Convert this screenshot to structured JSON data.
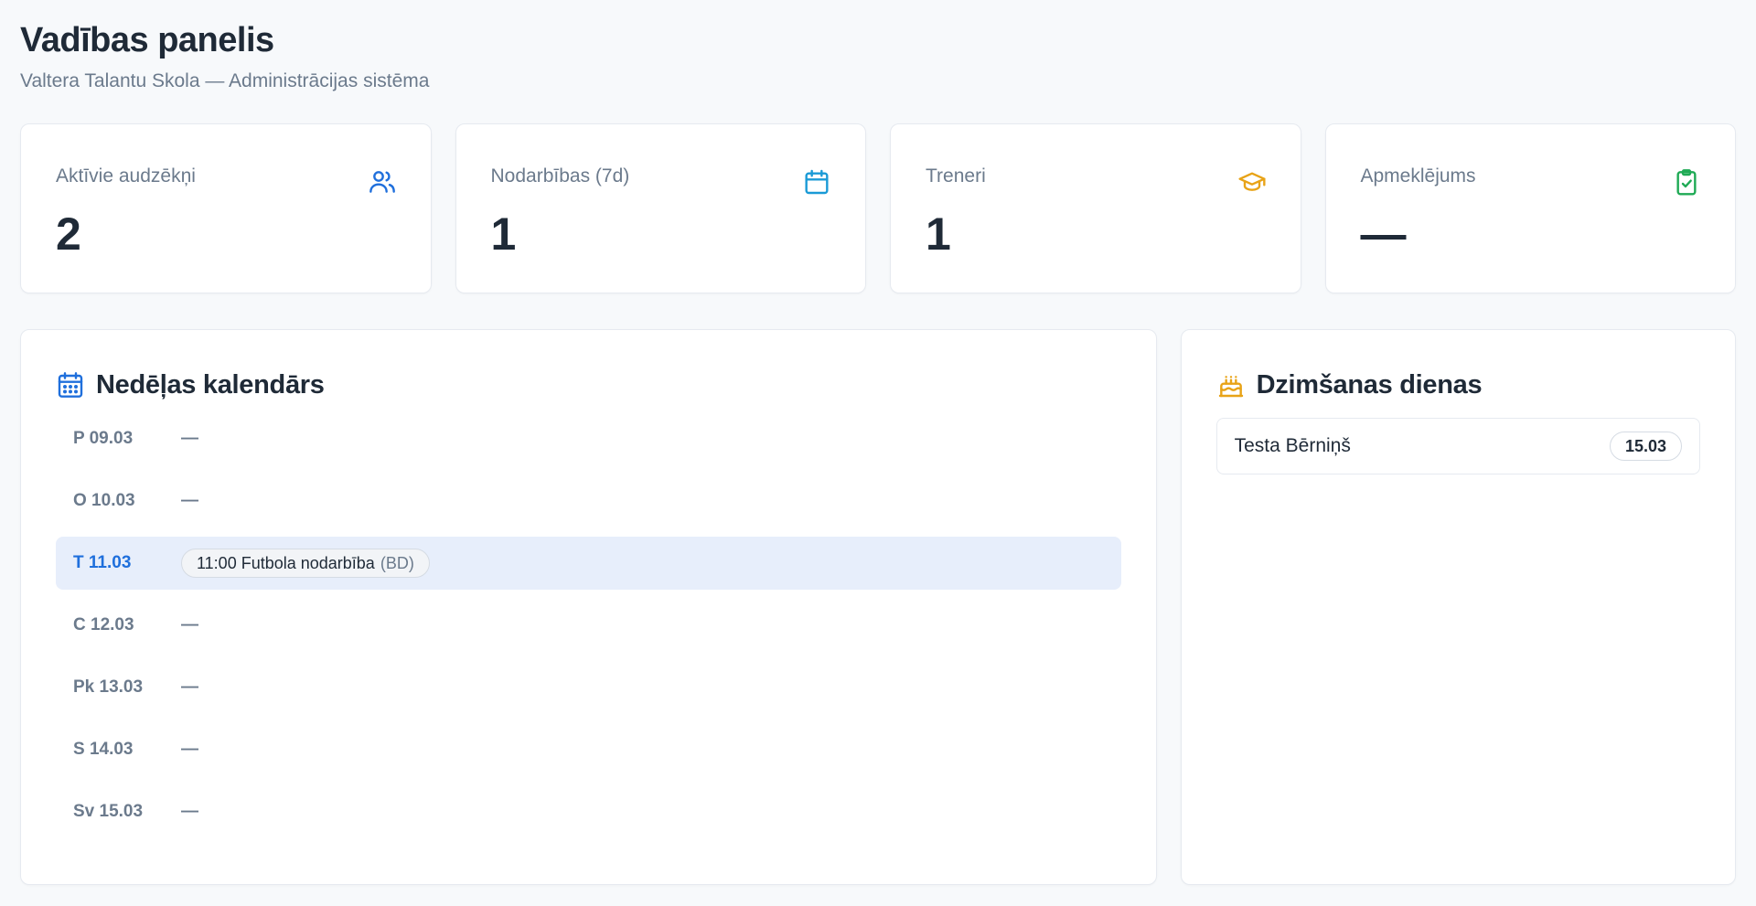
{
  "header": {
    "title": "Vadības panelis",
    "subtitle": "Valtera Talantu Skola — Administrācijas sistēma"
  },
  "stats": [
    {
      "label": "Aktīvie audzēkņi",
      "value": "2",
      "icon": "users-icon",
      "color": "#1f6fdc"
    },
    {
      "label": "Nodarbības (7d)",
      "value": "1",
      "icon": "calendar-icon",
      "color": "#1a9ad6"
    },
    {
      "label": "Treneri",
      "value": "1",
      "icon": "graduation-cap-icon",
      "color": "#e8a317"
    },
    {
      "label": "Apmeklējums",
      "value": "—",
      "icon": "clipboard-check-icon",
      "color": "#1faa55"
    }
  ],
  "calendar": {
    "title": "Nedēļas kalendārs",
    "icon": "calendar-days-icon",
    "days": [
      {
        "day": "P 09.03",
        "text": "—"
      },
      {
        "day": "O 10.03",
        "text": "—"
      },
      {
        "day": "T 11.03",
        "event": "11:00 Futbola nodarbība",
        "location": "(BD)"
      },
      {
        "day": "C 12.03",
        "text": "—"
      },
      {
        "day": "Pk 13.03",
        "text": "—"
      },
      {
        "day": "S 14.03",
        "text": "—"
      },
      {
        "day": "Sv 15.03",
        "text": "—"
      }
    ]
  },
  "birthdays": {
    "title": "Dzimšanas dienas",
    "icon": "cake-icon",
    "items": [
      {
        "name": "Testa Bērniņš",
        "date": "15.03"
      }
    ]
  }
}
